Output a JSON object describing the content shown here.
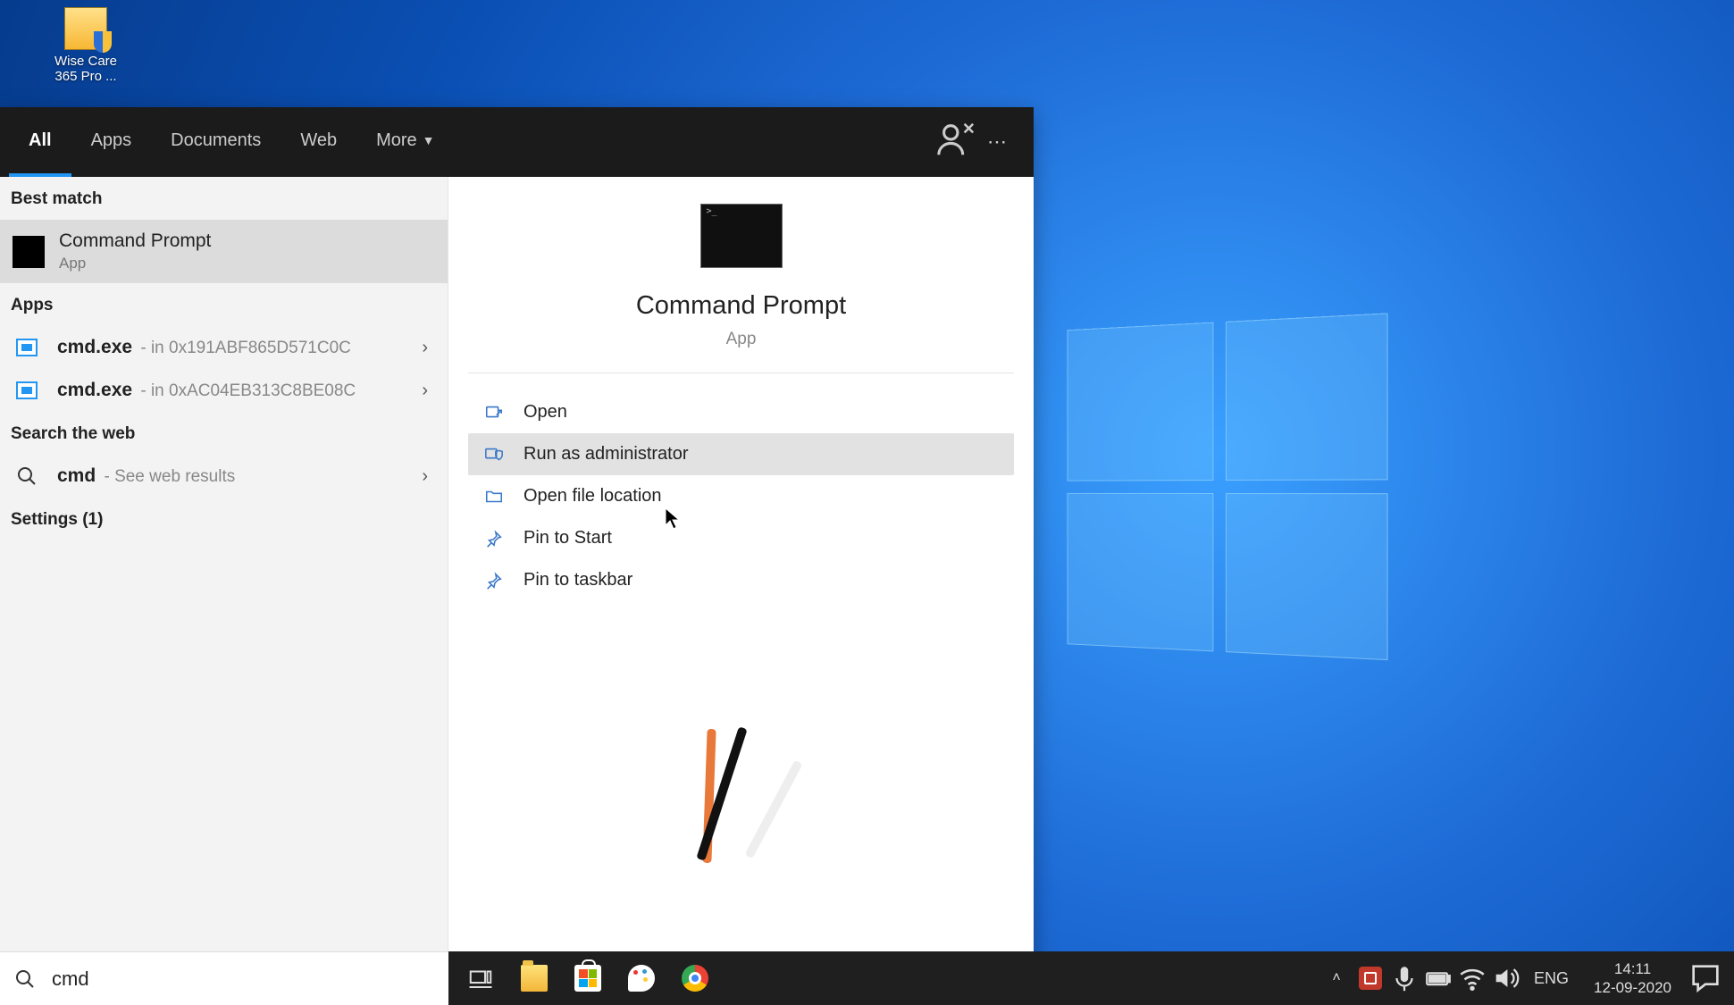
{
  "desktop": {
    "icon_label": "Wise Care 365 Pro ..."
  },
  "search": {
    "tabs": {
      "all": "All",
      "apps": "Apps",
      "documents": "Documents",
      "web": "Web",
      "more": "More"
    },
    "sections": {
      "best_match": "Best match",
      "apps": "Apps",
      "search_web": "Search the web",
      "settings": "Settings (1)"
    },
    "best_match": {
      "title": "Command Prompt",
      "sub": "App"
    },
    "apps_list": [
      {
        "name": "cmd.exe",
        "loc": " - in 0x191ABF865D571C0C"
      },
      {
        "name": "cmd.exe",
        "loc": " - in 0xAC04EB313C8BE08C"
      }
    ],
    "web": {
      "term": "cmd",
      "suffix": " - See web results"
    },
    "preview": {
      "title": "Command Prompt",
      "sub": "App"
    },
    "actions": {
      "open": "Open",
      "run_admin": "Run as administrator",
      "open_loc": "Open file location",
      "pin_start": "Pin to Start",
      "pin_taskbar": "Pin to taskbar"
    },
    "input_value": "cmd"
  },
  "taskbar": {
    "lang": "ENG",
    "time": "14:11",
    "date": "12-09-2020"
  }
}
